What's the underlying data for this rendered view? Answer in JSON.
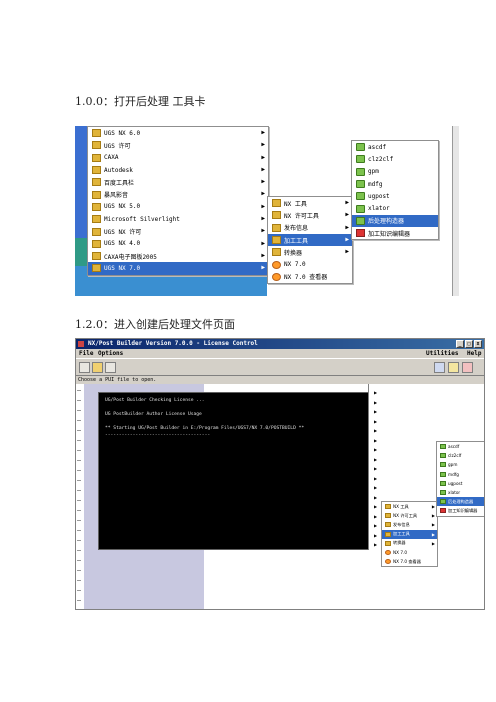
{
  "headings": {
    "step1": "1.0.0：打开后处理 工具卡",
    "step2": "1.2.0：进入创建后处理文件页面"
  },
  "start_menu": {
    "main_items": [
      {
        "label": "UGS NX 6.0",
        "icon": "folder-icon",
        "submenu": true
      },
      {
        "label": "UGS 许可",
        "icon": "folder-icon",
        "submenu": true
      },
      {
        "label": "CAXA",
        "icon": "folder-icon",
        "submenu": true
      },
      {
        "label": "Autodesk",
        "icon": "folder-icon",
        "submenu": true
      },
      {
        "label": "百度工具栏",
        "icon": "folder-icon",
        "submenu": true
      },
      {
        "label": "暴风影音",
        "icon": "folder-icon",
        "submenu": true
      },
      {
        "label": "UGS NX 5.0",
        "icon": "folder-icon",
        "submenu": true
      },
      {
        "label": "Microsoft Silverlight",
        "icon": "folder-icon",
        "submenu": true
      },
      {
        "label": "UGS NX 许可",
        "icon": "folder-icon",
        "submenu": true
      },
      {
        "label": "UGS NX 4.0",
        "icon": "folder-icon",
        "submenu": true
      },
      {
        "label": "CAXA电子图板2005",
        "icon": "folder-icon",
        "submenu": true
      },
      {
        "label": "UGS NX 7.0",
        "icon": "folder-icon",
        "submenu": true
      }
    ],
    "nx7_items": [
      {
        "label": "NX 工具",
        "icon": "folder-icon",
        "submenu": true
      },
      {
        "label": "NX 许可工具",
        "icon": "folder-icon",
        "submenu": true
      },
      {
        "label": "发布信息",
        "icon": "folder-icon",
        "submenu": true
      },
      {
        "label": "加工工具",
        "icon": "folder-icon",
        "submenu": true
      },
      {
        "label": "转换器",
        "icon": "folder-icon",
        "submenu": true
      },
      {
        "label": "NX 7.0",
        "icon": "nx-icon",
        "submenu": false
      },
      {
        "label": "NX 7.0 查看器",
        "icon": "nx-icon",
        "submenu": false
      }
    ],
    "machining_items": [
      {
        "label": "ascdf",
        "icon": "app-icon"
      },
      {
        "label": "clz2clf",
        "icon": "app-icon"
      },
      {
        "label": "gpm",
        "icon": "app-icon"
      },
      {
        "label": "mdfg",
        "icon": "app-icon"
      },
      {
        "label": "ugpost",
        "icon": "app-icon"
      },
      {
        "label": "xlator",
        "icon": "app-icon"
      },
      {
        "label": "后处理构造器",
        "icon": "app-icon"
      },
      {
        "label": "加工知识编辑器",
        "icon": "grid-icon"
      }
    ],
    "selected": {
      "main": "UGS NX 7.0",
      "nx7": "加工工具",
      "machining": "后处理构造器"
    }
  },
  "post_builder": {
    "window_title": "NX/Post Builder Version 7.0.0 - License Control",
    "menus": {
      "file": "File",
      "options": "Options",
      "utilities": "Utilities",
      "help": "Help"
    },
    "status": "Choose a PUI file to open.",
    "console_lines": [
      "UG/Post Builder Checking License ...",
      "",
      "UG PostBuilder Author License Usage",
      "",
      "** Starting UG/Post Builder in E:/Program Files/UGS7/NX 7.0/POSTBUILD **",
      "--------------------------------------"
    ]
  }
}
